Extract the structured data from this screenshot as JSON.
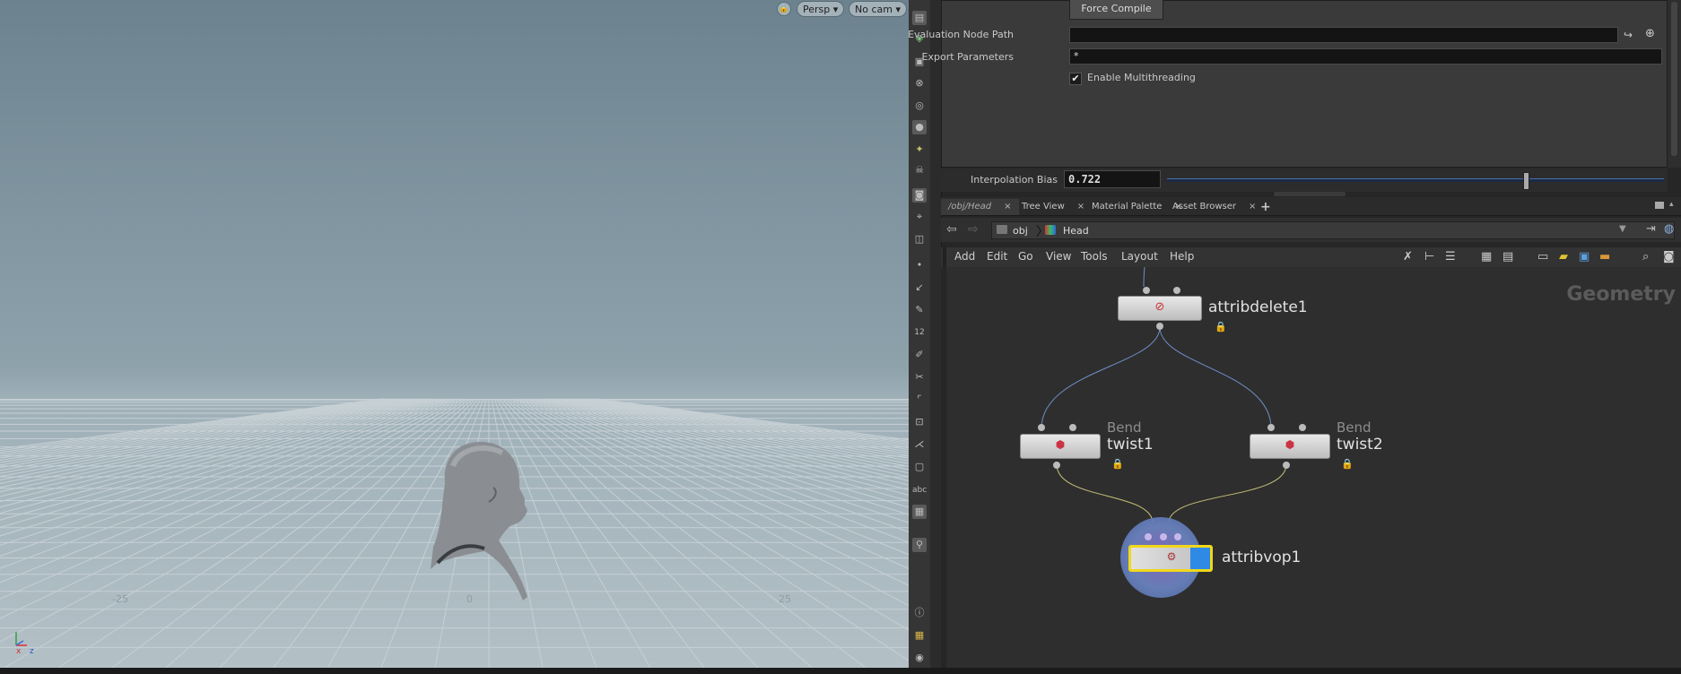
{
  "viewport": {
    "persp_label": "Persp ▾",
    "cam_label": "No cam ▾",
    "grid_labels": [
      "-25",
      "0",
      "25"
    ]
  },
  "shelf": {
    "text_tool": "abc",
    "num_tool": "12"
  },
  "params": {
    "force_compile": "Force Compile",
    "eval_path_label": "Evaluation Node Path",
    "eval_path_value": "",
    "export_label": "Export Parameters",
    "export_value": "*",
    "multithread_label": "Enable Multithreading",
    "interp_label": "Interpolation Bias",
    "interp_value": "0.722",
    "interp_fraction": 0.722
  },
  "tabs": [
    {
      "label": "/obj/Head"
    },
    {
      "label": "Tree View"
    },
    {
      "label": "Material Palette"
    },
    {
      "label": "Asset Browser"
    }
  ],
  "tab_close": "×",
  "tab_add": "+",
  "path": {
    "root": "obj",
    "node": "Head"
  },
  "menu": [
    "Add",
    "Edit",
    "Go",
    "View",
    "Tools",
    "Layout",
    "Help"
  ],
  "network": {
    "context_label": "Geometry",
    "nodes": {
      "attribdelete": "attribdelete1",
      "twist1_type": "Bend",
      "twist1": "twist1",
      "twist2_type": "Bend",
      "twist2": "twist2",
      "attribvop": "attribvop1"
    }
  },
  "colors": {
    "wire_blue": "#6f8fc9",
    "wire_yellow": "#c9c27a",
    "selected": "#f0d81a",
    "context_label": "#5b5b5b"
  }
}
